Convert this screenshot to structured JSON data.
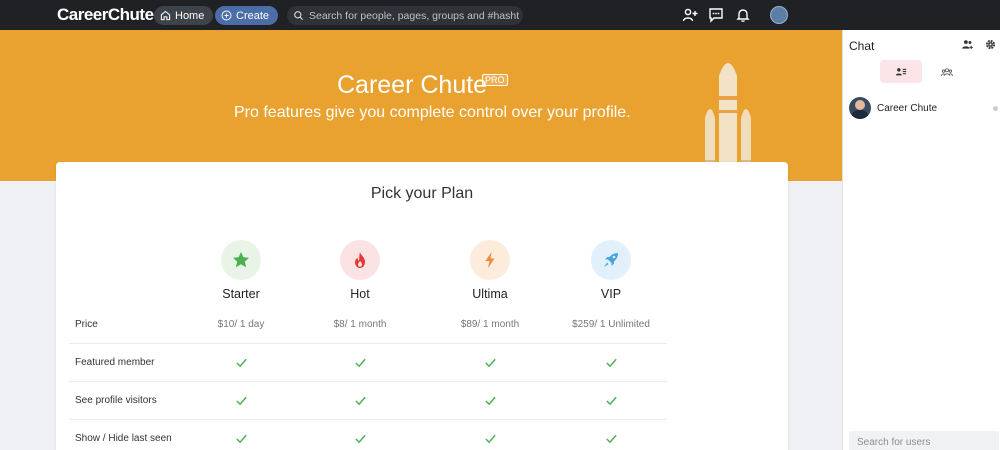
{
  "topbar": {
    "logo": "CareerChute",
    "home_label": "Home",
    "create_label": "Create",
    "search_placeholder": "Search for people, pages, groups and #hashtags",
    "icons": [
      "add-friend-icon",
      "messages-icon",
      "notifications-icon",
      "profile-avatar"
    ]
  },
  "hero": {
    "title": "Career Chute",
    "badge": "PRO",
    "subtitle": "Pro features give you complete control over your profile.",
    "bg_color": "#e9a22f"
  },
  "plans": {
    "heading": "Pick your Plan",
    "columns": [
      {
        "name": "Starter",
        "icon": "star-icon",
        "color": "#4caf50",
        "bg": "#e8f4e5"
      },
      {
        "name": "Hot",
        "icon": "fire-icon",
        "color": "#e53935",
        "bg": "#fbe3e3"
      },
      {
        "name": "Ultima",
        "icon": "lightning-icon",
        "color": "#f08a3c",
        "bg": "#fdebdc"
      },
      {
        "name": "VIP",
        "icon": "rocket-icon",
        "color": "#4aa3e0",
        "bg": "#e1f0fb"
      }
    ],
    "rows": [
      {
        "label": "Price",
        "values": [
          "$10/ 1 day",
          "$8/ 1 month",
          "$89/ 1 month",
          "$259/ 1 Unlimited"
        ]
      },
      {
        "label": "Featured member",
        "values": [
          "check",
          "check",
          "check",
          "check"
        ]
      },
      {
        "label": "See profile visitors",
        "values": [
          "check",
          "check",
          "check",
          "check"
        ]
      },
      {
        "label": "Show / Hide last seen",
        "values": [
          "check",
          "check",
          "check",
          "check"
        ]
      }
    ],
    "check_color": "#4caf50"
  },
  "chat": {
    "title": "Chat",
    "users": [
      {
        "name": "Career Chute"
      }
    ],
    "search_placeholder": "Search for users"
  }
}
